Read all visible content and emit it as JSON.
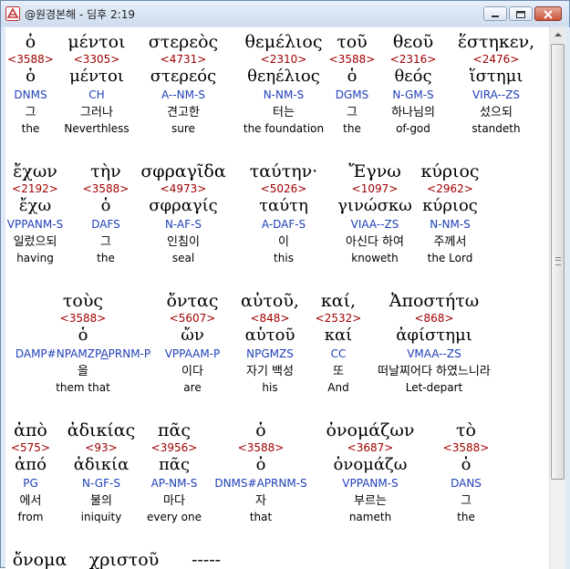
{
  "window": {
    "title": "@원경본해 - 딤후 2:19"
  },
  "rows": [
    {
      "words": [
        {
          "greek": "ὁ",
          "strong": "<3588>",
          "lemma": "ὁ",
          "parse": "DNMS",
          "korean": "그",
          "english": "the"
        },
        {
          "greek": "μέντοι",
          "strong": "<3305>",
          "lemma": "μέντοι",
          "parse": "CH",
          "korean": "그러나",
          "english": "Neverthless"
        },
        {
          "greek": "στερεὸς",
          "strong": "<4731>",
          "lemma": "στερεός",
          "parse": "A--NM-S",
          "korean": "견고한",
          "english": "sure"
        },
        {
          "greek": "θεμέλιος",
          "strong": "<2310>",
          "lemma": "θεηέλιος",
          "parse": "N-NM-S",
          "korean": "터는",
          "english": "the foundation"
        },
        {
          "greek": "τοῦ",
          "strong": "<3588>",
          "lemma": "ὁ",
          "parse": "DGMS",
          "korean": "그",
          "english": "the"
        },
        {
          "greek": "θεοῦ",
          "strong": "<2316>",
          "lemma": "θεός",
          "parse": "N-GM-S",
          "korean": "하나님의",
          "english": "of-god"
        },
        {
          "greek": "ἕστηκεν,",
          "strong": "<2476>",
          "lemma": "ἵστημι",
          "parse": "VIRA--ZS",
          "korean": "섰으되",
          "english": "standeth"
        }
      ]
    },
    {
      "words": [
        {
          "greek": "ἔχων",
          "strong": "<2192>",
          "lemma": "ἔχω",
          "parse": "VPPANM-S",
          "korean": "일렀으되",
          "english": "having"
        },
        {
          "greek": "τὴν",
          "strong": "<3588>",
          "lemma": "ὁ",
          "parse": "DAFS",
          "korean": "그",
          "english": "the"
        },
        {
          "greek": "σφραγῖδα",
          "strong": "<4973>",
          "lemma": "σφραγίς",
          "parse": "N-AF-S",
          "korean": "인침이",
          "english": "seal"
        },
        {
          "greek": "ταύτην·",
          "strong": "<5026>",
          "lemma": "ταύτη",
          "parse": "A-DAF-S",
          "korean": "이",
          "english": "this"
        },
        {
          "greek": "Ἔγνω",
          "strong": "<1097>",
          "lemma": "γινώσκω",
          "parse": "VIAA--ZS",
          "korean": "아신다 하여",
          "english": "knoweth"
        },
        {
          "greek": "κύριος",
          "strong": "<2962>",
          "lemma": "κύριος",
          "parse": "N-NM-S",
          "korean": "주께서",
          "english": "the Lord"
        }
      ]
    },
    {
      "words": [
        {
          "greek": "τοὺς",
          "strong": "<3588>",
          "lemma": "ὁ",
          "parse_pre": "DAMP#NPAMZP",
          "parse_u": "A",
          "parse_post": "PRNM-P",
          "korean": "을",
          "english": "them that"
        },
        {
          "greek": "ὄντας",
          "strong": "<5607>",
          "lemma": "ὤν",
          "parse": "VPPAAM-P",
          "korean": "이다",
          "english": "are"
        },
        {
          "greek": "αὐτοῦ,",
          "strong": "<848>",
          "lemma": "αὑτοῦ",
          "parse": "NPGMZS",
          "korean": "자기 백성",
          "english": "his"
        },
        {
          "greek": "καί,",
          "strong": "<2532>",
          "lemma": "καί",
          "parse": "CC",
          "korean": "또",
          "english": "And"
        },
        {
          "greek": "Ἀποστήτω",
          "strong": "<868>",
          "lemma": "ἀφίστημι",
          "parse": "VMAA--ZS",
          "korean": "떠날찌어다 하였느니라",
          "english": "Let-depart"
        }
      ]
    },
    {
      "words": [
        {
          "greek": "ἀπὸ",
          "strong": "<575>",
          "lemma": "ἀπό",
          "parse": "PG",
          "korean": "에서",
          "english": "from"
        },
        {
          "greek": "ἀδικίας",
          "strong": "<93>",
          "lemma": "ἀδικία",
          "parse": "N-GF-S",
          "korean": "불의",
          "english": "iniquity"
        },
        {
          "greek": "πᾶς",
          "strong": "<3956>",
          "lemma": "πᾶς",
          "parse": "AP-NM-S",
          "korean": "마다",
          "english": "every one"
        },
        {
          "greek": "ὁ",
          "strong": "<3588>",
          "lemma": "ὁ",
          "parse": "DNMS#APRNM-S",
          "korean": "자",
          "english": "that"
        },
        {
          "greek": "ὀνομάζων",
          "strong": "<3687>",
          "lemma": "ὀνομάζω",
          "parse": "VPPANM-S",
          "korean": "부르는",
          "english": "nameth"
        },
        {
          "greek": "τὸ",
          "strong": "<3588>",
          "lemma": "ὁ",
          "parse": "DANS",
          "korean": "그",
          "english": "the"
        }
      ]
    },
    {
      "words": [
        {
          "greek": "ὄνομα"
        },
        {
          "greek": "χριστοῦ"
        },
        {
          "greek": "-----"
        }
      ]
    }
  ]
}
